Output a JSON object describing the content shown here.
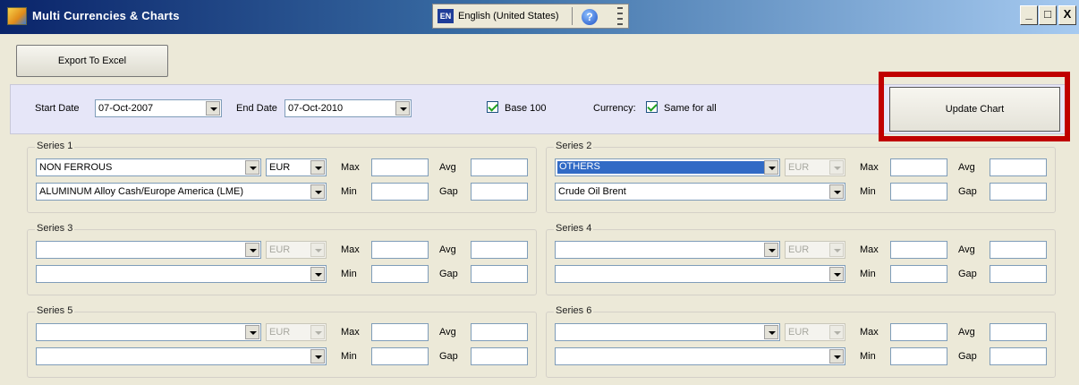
{
  "window": {
    "title": "Multi Currencies & Charts",
    "language_badge": "EN",
    "language": "English (United States)",
    "help_glyph": "?",
    "controls": {
      "minimize": "_",
      "maximize": "□",
      "close": "X"
    }
  },
  "toolbar": {
    "export_label": "Export To Excel"
  },
  "filters": {
    "start_label": "Start Date",
    "start_value": "07-Oct-2007",
    "end_label": "End Date",
    "end_value": "07-Oct-2010",
    "base100_label": "Base 100",
    "base100_checked": true,
    "currency_label": "Currency:",
    "same_for_all_label": "Same for all",
    "same_for_all_checked": true,
    "update_label": "Update Chart"
  },
  "series_labels": {
    "max": "Max",
    "avg": "Avg",
    "min": "Min",
    "gap": "Gap"
  },
  "series": [
    {
      "title": "Series 1",
      "category": "NON FERROUS",
      "currency": "EUR",
      "commodity": "ALUMINUM Alloy Cash/Europe America (LME)",
      "max": "",
      "avg": "",
      "min": "",
      "gap": ""
    },
    {
      "title": "Series 2",
      "category": "OTHERS",
      "currency": "EUR",
      "commodity": "Crude Oil Brent",
      "max": "",
      "avg": "",
      "min": "",
      "gap": ""
    },
    {
      "title": "Series 3",
      "category": "",
      "currency": "EUR",
      "commodity": "",
      "max": "",
      "avg": "",
      "min": "",
      "gap": ""
    },
    {
      "title": "Series 4",
      "category": "",
      "currency": "EUR",
      "commodity": "",
      "max": "",
      "avg": "",
      "min": "",
      "gap": ""
    },
    {
      "title": "Series 5",
      "category": "",
      "currency": "EUR",
      "commodity": "",
      "max": "",
      "avg": "",
      "min": "",
      "gap": ""
    },
    {
      "title": "Series 6",
      "category": "",
      "currency": "EUR",
      "commodity": "",
      "max": "",
      "avg": "",
      "min": "",
      "gap": ""
    }
  ],
  "colors": {
    "highlight": "#c00000",
    "selection": "#316ac5",
    "panel": "#e6e6f8"
  }
}
